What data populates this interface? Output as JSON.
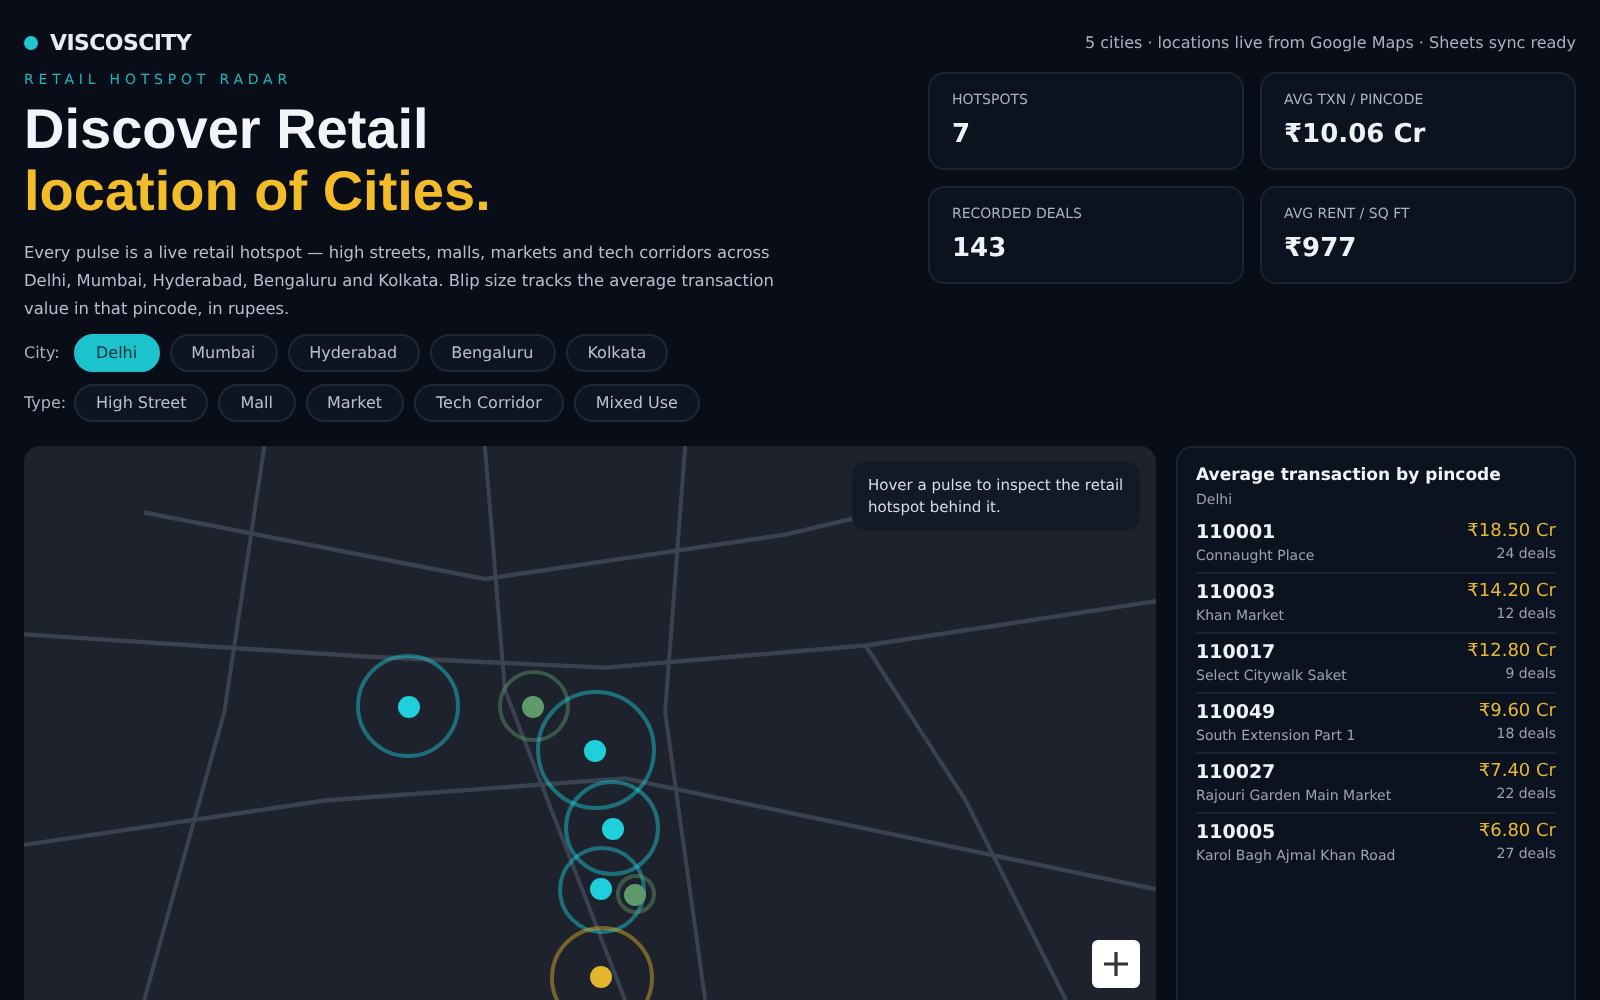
{
  "brand": {
    "name": "VISCOSCITY"
  },
  "status": "5 cities · locations live from Google Maps · Sheets sync ready",
  "eyebrow": "RETAIL HOTSPOT RADAR",
  "headline": {
    "line_1": "Discover Retail",
    "line_2": "location of Cities."
  },
  "intro": "Every pulse is a live retail hotspot — high streets, malls, markets and tech corridors across Delhi, Mumbai, Hyderabad, Bengaluru and Kolkata. Blip size tracks the average transaction value in that pincode, in rupees.",
  "city_filter": {
    "label": "City:",
    "options": [
      {
        "label": "Delhi",
        "selected": true
      },
      {
        "label": "Mumbai",
        "selected": false
      },
      {
        "label": "Hyderabad",
        "selected": false
      },
      {
        "label": "Bengaluru",
        "selected": false
      },
      {
        "label": "Kolkata",
        "selected": false
      }
    ]
  },
  "type_filter": {
    "label": "Type:",
    "options": [
      {
        "label": "High Street",
        "selected": false
      },
      {
        "label": "Mall",
        "selected": false
      },
      {
        "label": "Market",
        "selected": false
      },
      {
        "label": "Tech Corridor",
        "selected": false
      },
      {
        "label": "Mixed Use",
        "selected": false
      }
    ]
  },
  "stats": [
    {
      "label": "HOTSPOTS",
      "value": "7"
    },
    {
      "label": "AVG TXN / PINCODE",
      "value": "₹10.06 Cr"
    },
    {
      "label": "RECORDED DEALS",
      "value": "143"
    },
    {
      "label": "AVG RENT / SQ FT",
      "value": "₹977"
    }
  ],
  "map": {
    "tooltip": "Hover a pulse to inspect the retail hotspot behind it.",
    "pulses": [
      {
        "color": "#1fd0dc"
      },
      {
        "color": "#5f9a6a"
      },
      {
        "color": "#1fd0dc"
      },
      {
        "color": "#1fd0dc"
      },
      {
        "color": "#1fd0dc"
      },
      {
        "color": "#5f9a6a"
      },
      {
        "color": "#e3b52c"
      }
    ]
  },
  "ranking": {
    "title": "Average transaction by pincode",
    "city": "Delhi",
    "rows": [
      {
        "pincode": "110001",
        "area": "Connaught Place",
        "value": "₹18.50 Cr",
        "deals": "24 deals"
      },
      {
        "pincode": "110003",
        "area": "Khan Market",
        "value": "₹14.20 Cr",
        "deals": "12 deals"
      },
      {
        "pincode": "110017",
        "area": "Select Citywalk Saket",
        "value": "₹12.80 Cr",
        "deals": "9 deals"
      },
      {
        "pincode": "110049",
        "area": "South Extension Part 1",
        "value": "₹9.60 Cr",
        "deals": "18 deals"
      },
      {
        "pincode": "110027",
        "area": "Rajouri Garden Main Market",
        "value": "₹7.40 Cr",
        "deals": "22 deals"
      },
      {
        "pincode": "110005",
        "area": "Karol Bagh Ajmal Khan Road",
        "value": "₹6.80 Cr",
        "deals": "27 deals"
      }
    ]
  }
}
